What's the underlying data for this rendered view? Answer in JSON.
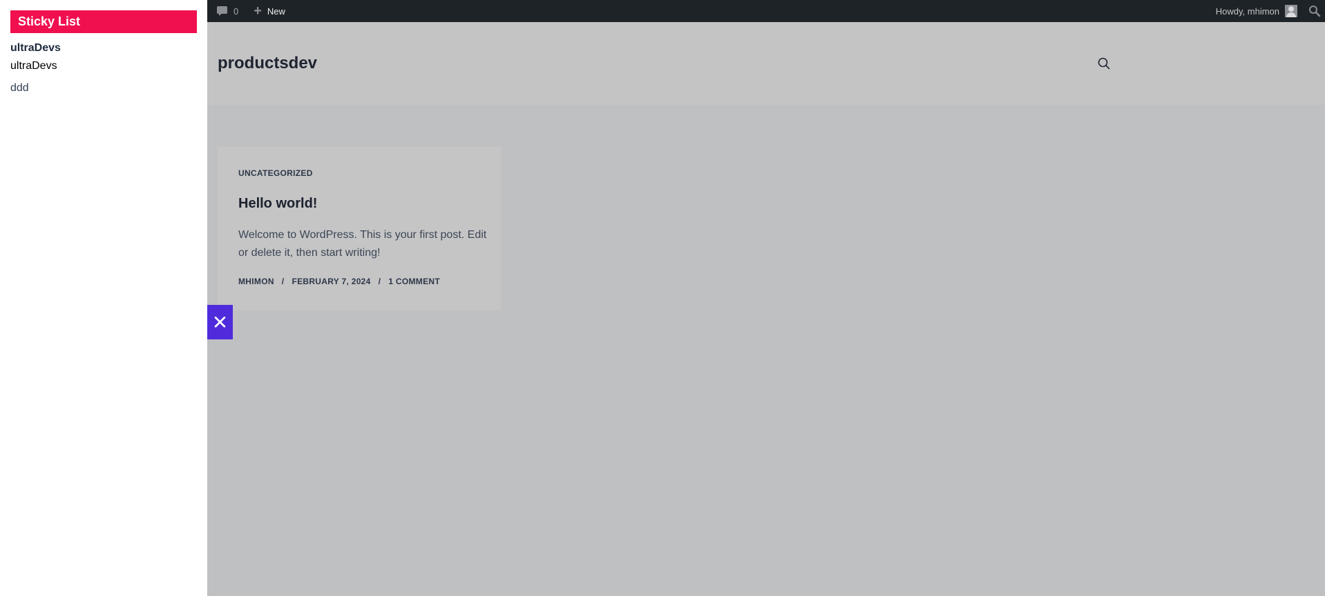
{
  "adminbar": {
    "comments_count": "0",
    "new_label": "New",
    "greeting": "Howdy, mhimon"
  },
  "sidebar": {
    "title": "Sticky List",
    "items": [
      {
        "label": "ultraDevs"
      },
      {
        "label": "ultraDevs"
      },
      {
        "label": "ddd"
      }
    ]
  },
  "close_button": {
    "label": "✕"
  },
  "header": {
    "site_title": "productsdev"
  },
  "post": {
    "category": "UNCATEGORIZED",
    "title": "Hello world!",
    "excerpt": "Welcome to WordPress. This is your first post. Edit or delete it, then start writing!",
    "author": "MHIMON",
    "date": "FEBRUARY 7, 2024",
    "comments": "1 COMMENT",
    "separator": "/"
  },
  "colors": {
    "sticky_title_bg": "#f0104f",
    "close_button_bg": "#4f2bdb",
    "adminbar_bg": "#1d2327"
  }
}
